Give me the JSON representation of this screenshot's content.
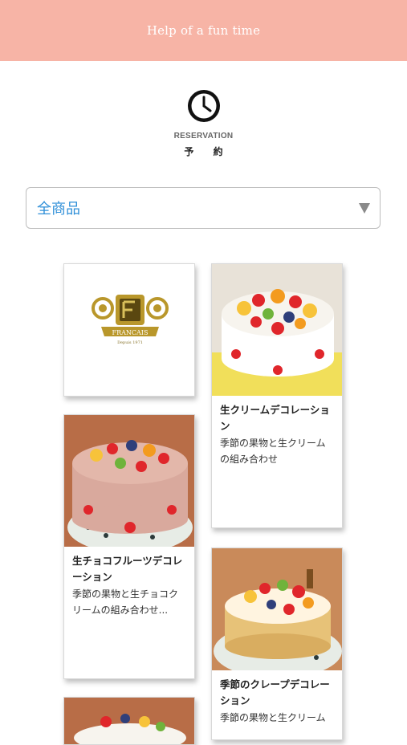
{
  "header": {
    "title": "Help of a fun time"
  },
  "section": {
    "en": "RESERVATION",
    "jp": "予 約"
  },
  "filter": {
    "selected": "全商品"
  },
  "brand_logo": {
    "text": "FRANCAIS",
    "subtext": "Depuis 1971"
  },
  "products": [
    {
      "name": "生クリームデコレーション",
      "desc": "季節の果物と生クリームの組み合わせ"
    },
    {
      "name": "生チョコフルーツデコレーション",
      "desc": "季節の果物と生チョコクリームの組み合わせ..."
    },
    {
      "name": "季節のクレープデコレーション",
      "desc": "季節の果物と生クリーム"
    }
  ],
  "colors": {
    "header_bg": "#f7b4a6",
    "select_text": "#2f8fd8",
    "logo_gold": "#b9972b"
  }
}
